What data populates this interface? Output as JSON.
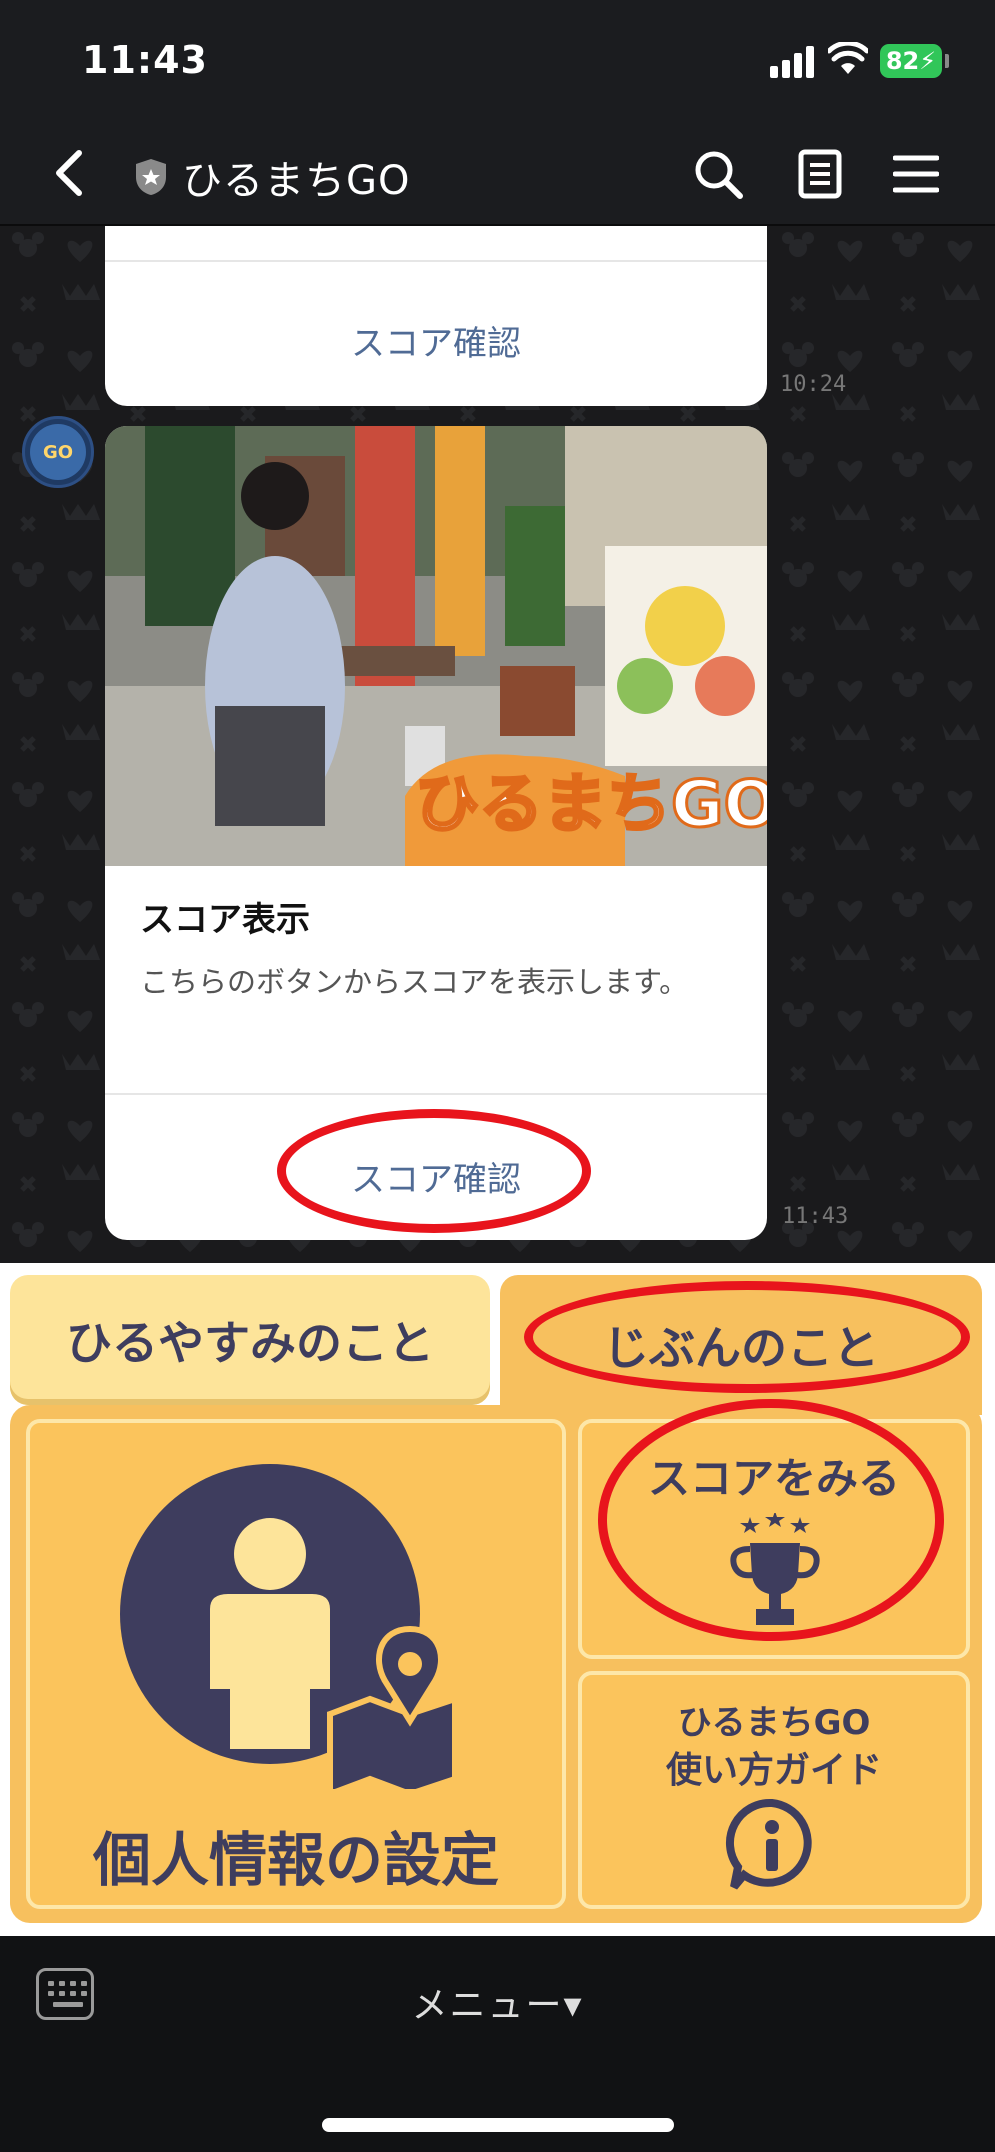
{
  "status_bar": {
    "time": "11:43",
    "battery": "82"
  },
  "header": {
    "title": "ひるまちGO"
  },
  "chat": {
    "prev_card": {
      "button_label": "スコア確認",
      "time": "10:24"
    },
    "card": {
      "title": "スコア表示",
      "description": "こちらのボタンからスコアを表示します。",
      "button_label": "スコア確認",
      "time": "11:43",
      "image_caption": "ひるまちGO"
    },
    "avatar_text": "GO"
  },
  "rich_menu": {
    "tabs": [
      {
        "label": "ひるやすみのこと"
      },
      {
        "label": "じぶんのこと"
      }
    ],
    "profile_label": "個人情報の設定",
    "score_label": "スコアをみる",
    "guide_label_line1": "ひるまちGO",
    "guide_label_line2": "使い方ガイド",
    "colors": {
      "tile": "#fbc45c",
      "ink": "#3e3d5e",
      "highlight": "#e8141c"
    }
  },
  "bottom_bar": {
    "menu_label": "メニュー▾"
  }
}
